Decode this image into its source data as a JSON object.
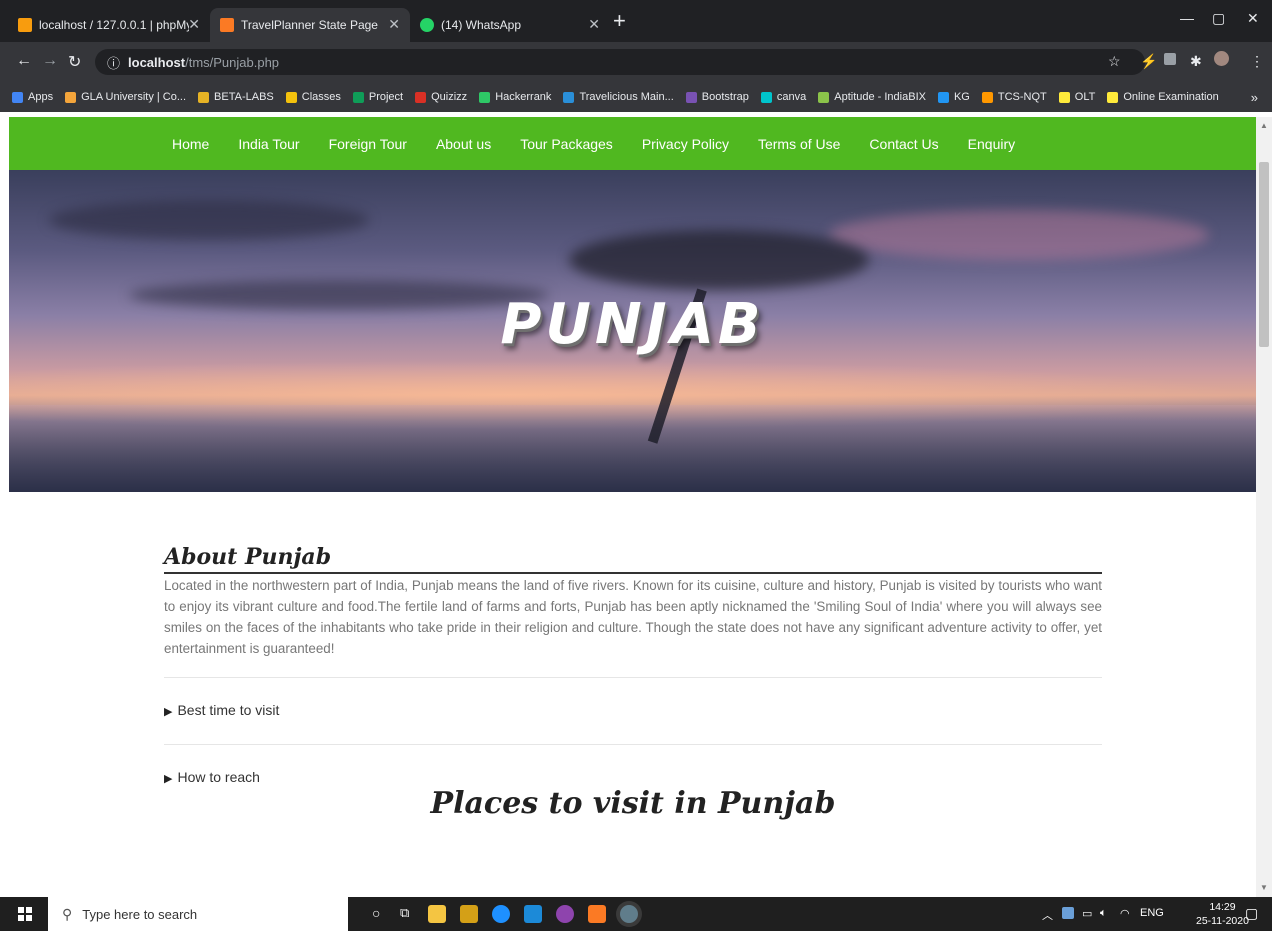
{
  "browser": {
    "tabs": [
      {
        "label": "localhost / 127.0.0.1 | phpMyAdm",
        "icon": "phpmyadmin-icon",
        "color": "#f89c0e",
        "active": false
      },
      {
        "label": "TravelPlanner State Page",
        "icon": "xampp-icon",
        "color": "#fb7a24",
        "active": true
      },
      {
        "label": "(14) WhatsApp",
        "icon": "whatsapp-icon",
        "color": "#25d366",
        "active": false
      }
    ],
    "new_tab": "+",
    "url_host": "localhost",
    "url_path": "/tms/Punjab.php",
    "bookmarks": [
      {
        "label": "Apps",
        "color": "#4285f4"
      },
      {
        "label": "GLA University | Co...",
        "color": "#f4a53b"
      },
      {
        "label": "BETA-LABS",
        "color": "#e6b325"
      },
      {
        "label": "Classes",
        "color": "#f4c20d"
      },
      {
        "label": "Project",
        "color": "#0f9d58"
      },
      {
        "label": "Quizizz",
        "color": "#d93025"
      },
      {
        "label": "Hackerrank",
        "color": "#2ec866"
      },
      {
        "label": "Travelicious Main...",
        "color": "#2a8fd8"
      },
      {
        "label": "Bootstrap",
        "color": "#7952b3"
      },
      {
        "label": "canva",
        "color": "#00c4cc"
      },
      {
        "label": "Aptitude - IndiaBIX",
        "color": "#8bc34a"
      },
      {
        "label": "KG",
        "color": "#2196f3"
      },
      {
        "label": "TCS-NQT",
        "color": "#ff9800"
      },
      {
        "label": "OLT",
        "color": "#ffeb3b"
      },
      {
        "label": "Online Examination",
        "color": "#ffeb3b"
      }
    ],
    "bookmarks_more": "»"
  },
  "site": {
    "nav": [
      "Home",
      "India Tour",
      "Foreign Tour",
      "About us",
      "Tour Packages",
      "Privacy Policy",
      "Terms of Use",
      "Contact Us",
      "Enquiry"
    ],
    "nav_color": "#50b820",
    "hero_title": "PUNJAB",
    "about_title": "About Punjab",
    "about_text": "Located in the northwestern part of India, Punjab means the land of five rivers. Known for its cuisine, culture and history, Punjab is visited by tourists who want to enjoy its vibrant culture and food.The fertile land of farms and forts, Punjab has been aptly nicknamed the 'Smiling Soul of India' where you will always see smiles on the faces of the inhabitants who take pride in their religion and culture. Though the state does not have any significant adventure activity to offer, yet entertainment is guaranteed!",
    "details": [
      "Best time to visit",
      "How to reach"
    ],
    "places_title": "Places to visit in Punjab"
  },
  "taskbar": {
    "search_placeholder": "Type here to search",
    "language": "ENG",
    "time": "14:29",
    "date": "25-11-2020"
  }
}
